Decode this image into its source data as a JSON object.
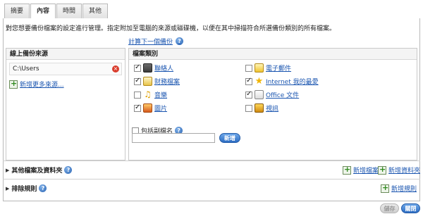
{
  "tabs": [
    {
      "label": "摘要"
    },
    {
      "label": "內容"
    },
    {
      "label": "時間"
    },
    {
      "label": "其他"
    }
  ],
  "intro_text": "對您想要備份檔案的設定進行管理。指定附加至電腦的來源或磁碟機，以便在其中掃描符合所選備份類別的所有檔案。",
  "calc_link": "計算下一個備份",
  "sources": {
    "header": "線上備份來源",
    "items": [
      {
        "path": "C:\\Users"
      }
    ],
    "add_label": "新增更多來源..."
  },
  "categories": {
    "header": "檔案類別",
    "items": [
      {
        "label": "聯絡人",
        "checked": true,
        "icon": "contacts-icon"
      },
      {
        "label": "財務檔案",
        "checked": true,
        "icon": "finance-icon"
      },
      {
        "label": "音樂",
        "checked": false,
        "icon": "music-icon"
      },
      {
        "label": "圖片",
        "checked": true,
        "icon": "pictures-icon"
      },
      {
        "label": "電子郵件",
        "checked": false,
        "icon": "email-icon"
      },
      {
        "label": "Internet 我的最愛",
        "checked": true,
        "icon": "favorites-star-icon"
      },
      {
        "label": "Office 文件",
        "checked": true,
        "icon": "office-document-icon"
      },
      {
        "label": "視訊",
        "checked": false,
        "icon": "video-icon"
      }
    ],
    "extension": {
      "label": "包括副檔名",
      "value": "",
      "add_label": "新增"
    }
  },
  "other_files": {
    "title": "其他檔案及資料夾",
    "add_file": "新增檔案",
    "add_folder": "新增資料夾"
  },
  "exclusion": {
    "title": "排除規則",
    "add_rule": "新增規則"
  },
  "buttons": {
    "save": "儲存",
    "close": "關閉"
  }
}
